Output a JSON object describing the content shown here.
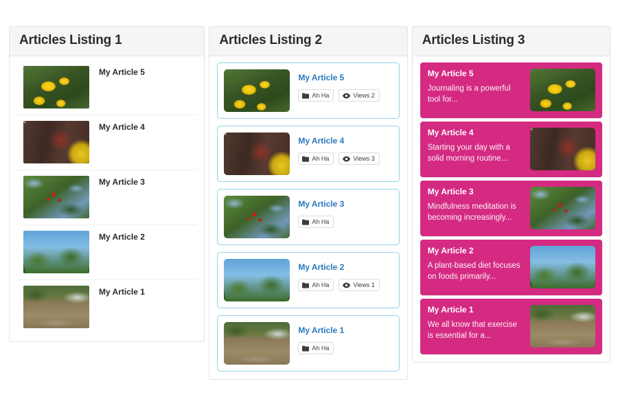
{
  "page": {
    "background_color": "#ffffff",
    "accent_pink": "#d42a82",
    "accent_blue": "#2779bd",
    "card_border_blue": "#93d2e9",
    "panel_border": "#e3e3e3",
    "panel_header_bg": "#f5f5f5"
  },
  "panels": [
    {
      "title": "Articles Listing 1",
      "items": [
        {
          "title": "My Article 5",
          "image": "yellow-flowers-photo"
        },
        {
          "title": "My Article 4",
          "image": "cobblestone-wall-photo"
        },
        {
          "title": "My Article 3",
          "image": "red-berries-photo"
        },
        {
          "title": "My Article 2",
          "image": "palm-trees-photo"
        },
        {
          "title": "My Article 1",
          "image": "muddy-river-photo"
        }
      ]
    },
    {
      "title": "Articles Listing 2",
      "items": [
        {
          "title": "My Article 5",
          "image": "yellow-flowers-photo",
          "badges": [
            {
              "icon": "folder-icon",
              "label": "Ah Ha"
            },
            {
              "icon": "eye-icon",
              "label": "Views 2"
            }
          ]
        },
        {
          "title": "My Article 4",
          "image": "cobblestone-wall-photo",
          "badges": [
            {
              "icon": "folder-icon",
              "label": "Ah Ha"
            },
            {
              "icon": "eye-icon",
              "label": "Views 3"
            }
          ]
        },
        {
          "title": "My Article 3",
          "image": "red-berries-photo",
          "badges": [
            {
              "icon": "folder-icon",
              "label": "Ah Ha"
            }
          ]
        },
        {
          "title": "My Article 2",
          "image": "palm-trees-photo",
          "badges": [
            {
              "icon": "folder-icon",
              "label": "Ah Ha"
            },
            {
              "icon": "eye-icon",
              "label": "Views 1"
            }
          ]
        },
        {
          "title": "My Article 1",
          "image": "muddy-river-photo",
          "badges": [
            {
              "icon": "folder-icon",
              "label": "Ah Ha"
            }
          ]
        }
      ]
    },
    {
      "title": "Articles Listing 3",
      "items": [
        {
          "title": "My Article 5",
          "excerpt": "Journaling is a powerful tool for...",
          "image": "yellow-flowers-photo"
        },
        {
          "title": "My Article 4",
          "excerpt": "Starting your day with a solid morning routine...",
          "image": "cobblestone-wall-photo"
        },
        {
          "title": "My Article 3",
          "excerpt": "Mindfulness meditation is becoming increasingly...",
          "image": "red-berries-photo"
        },
        {
          "title": "My Article 2",
          "excerpt": "A plant-based diet focuses on foods primarily...",
          "image": "muddy-palm-photo"
        },
        {
          "title": "My Article 1",
          "excerpt": "We all know that exercise is essential for a...",
          "image": "muddy-river-photo"
        }
      ]
    }
  ]
}
